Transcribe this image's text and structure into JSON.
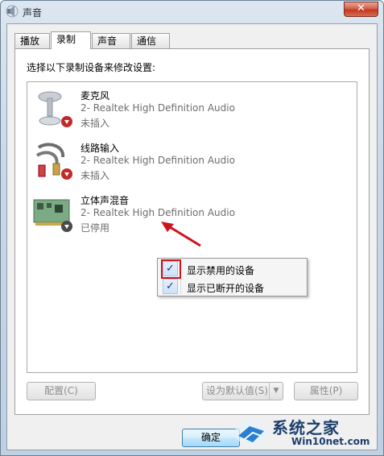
{
  "window": {
    "title": "声音",
    "close_glyph": "✕"
  },
  "tabs": [
    {
      "label": "播放",
      "active": false
    },
    {
      "label": "录制",
      "active": true
    },
    {
      "label": "声音",
      "active": false
    },
    {
      "label": "通信",
      "active": false
    }
  ],
  "panel": {
    "instruction": "选择以下录制设备来修改设置:"
  },
  "devices": [
    {
      "name": "麦克风",
      "desc": "2- Realtek High Definition Audio",
      "status": "未插入",
      "icon": "microphone-icon",
      "badge": "unplugged-red-arrow"
    },
    {
      "name": "线路输入",
      "desc": "2- Realtek High Definition Audio",
      "status": "未插入",
      "icon": "rca-cable-icon",
      "badge": "unplugged-red-arrow"
    },
    {
      "name": "立体声混音",
      "desc": "2- Realtek High Definition Audio",
      "status": "已停用",
      "icon": "sound-card-icon",
      "badge": "disabled-gray-arrow"
    }
  ],
  "context_menu": {
    "items": [
      {
        "label": "显示禁用的设备",
        "checked": true,
        "highlighted": true
      },
      {
        "label": "显示已断开的设备",
        "checked": true,
        "highlighted": false
      }
    ],
    "check_glyph": "✓"
  },
  "buttons": {
    "configure": "配置(C)",
    "set_default": "设为默认值(S)",
    "properties": "属性(P)",
    "ok": "确定"
  },
  "watermark": {
    "title": "系统之家",
    "url": "Win10net.com"
  },
  "colors": {
    "annotation_red": "#d0121b",
    "link_blue": "#1d3f6d"
  }
}
